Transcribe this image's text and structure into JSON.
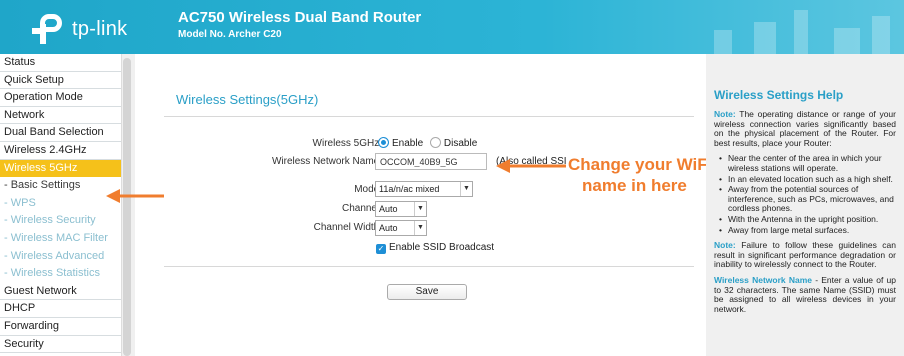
{
  "header": {
    "logo_text": "tp-link",
    "title": "AC750 Wireless Dual Band Router",
    "model": "Model No. Archer C20"
  },
  "sidebar": {
    "items": [
      {
        "label": "Status"
      },
      {
        "label": "Quick Setup"
      },
      {
        "label": "Operation Mode"
      },
      {
        "label": "Network"
      },
      {
        "label": "Dual Band Selection"
      },
      {
        "label": "Wireless 2.4GHz"
      },
      {
        "label": "Wireless 5GHz"
      },
      {
        "label": "- Basic Settings"
      },
      {
        "label": "- WPS"
      },
      {
        "label": "- Wireless Security"
      },
      {
        "label": "- Wireless MAC Filter"
      },
      {
        "label": "- Wireless Advanced"
      },
      {
        "label": "- Wireless Statistics"
      },
      {
        "label": "Guest Network"
      },
      {
        "label": "DHCP"
      },
      {
        "label": "Forwarding"
      },
      {
        "label": "Security"
      }
    ]
  },
  "main": {
    "title": "Wireless Settings(5GHz)",
    "wireless_label": "Wireless 5GHz:",
    "enable_label": "Enable",
    "disable_label": "Disable",
    "name_label": "Wireless Network Name:",
    "name_value": "OCCOM_40B9_5G",
    "name_note": "(Also called SSID)",
    "mode_label": "Mode:",
    "mode_value": "11a/n/ac mixed",
    "channel_label": "Channel:",
    "channel_value": "Auto",
    "width_label": "Channel Width:",
    "width_value": "Auto",
    "ssid_broadcast_label": "Enable SSID Broadcast",
    "save_label": "Save"
  },
  "annotation": {
    "line1": "Change your WiFi",
    "line2": "name in here",
    "color": "#f07d2e"
  },
  "help": {
    "title": "Wireless Settings Help",
    "note_label": "Note:",
    "p1": "The operating distance or range of your wireless connection varies significantly based on the physical placement of the Router. For best results, place your Router:",
    "bullets": [
      "Near the center of the area in which your wireless stations will operate.",
      "In an elevated location such as a high shelf.",
      "Away from the potential sources of interference, such as PCs, microwaves, and cordless phones.",
      "With the Antenna in the upright position.",
      "Away from large metal surfaces."
    ],
    "p2": "Failure to follow these guidelines can result in significant performance degradation or inability to wirelessly connect to the Router.",
    "p3_label": "Wireless Network Name",
    "p3": " - Enter a value of up to 32 characters. The same Name (SSID) must be assigned to all wireless devices in your network."
  },
  "colors": {
    "header": "#1fa6c9",
    "active_menu": "#f5c11a",
    "accent": "#2a9fc7",
    "help_bg": "#f0f0f0"
  }
}
